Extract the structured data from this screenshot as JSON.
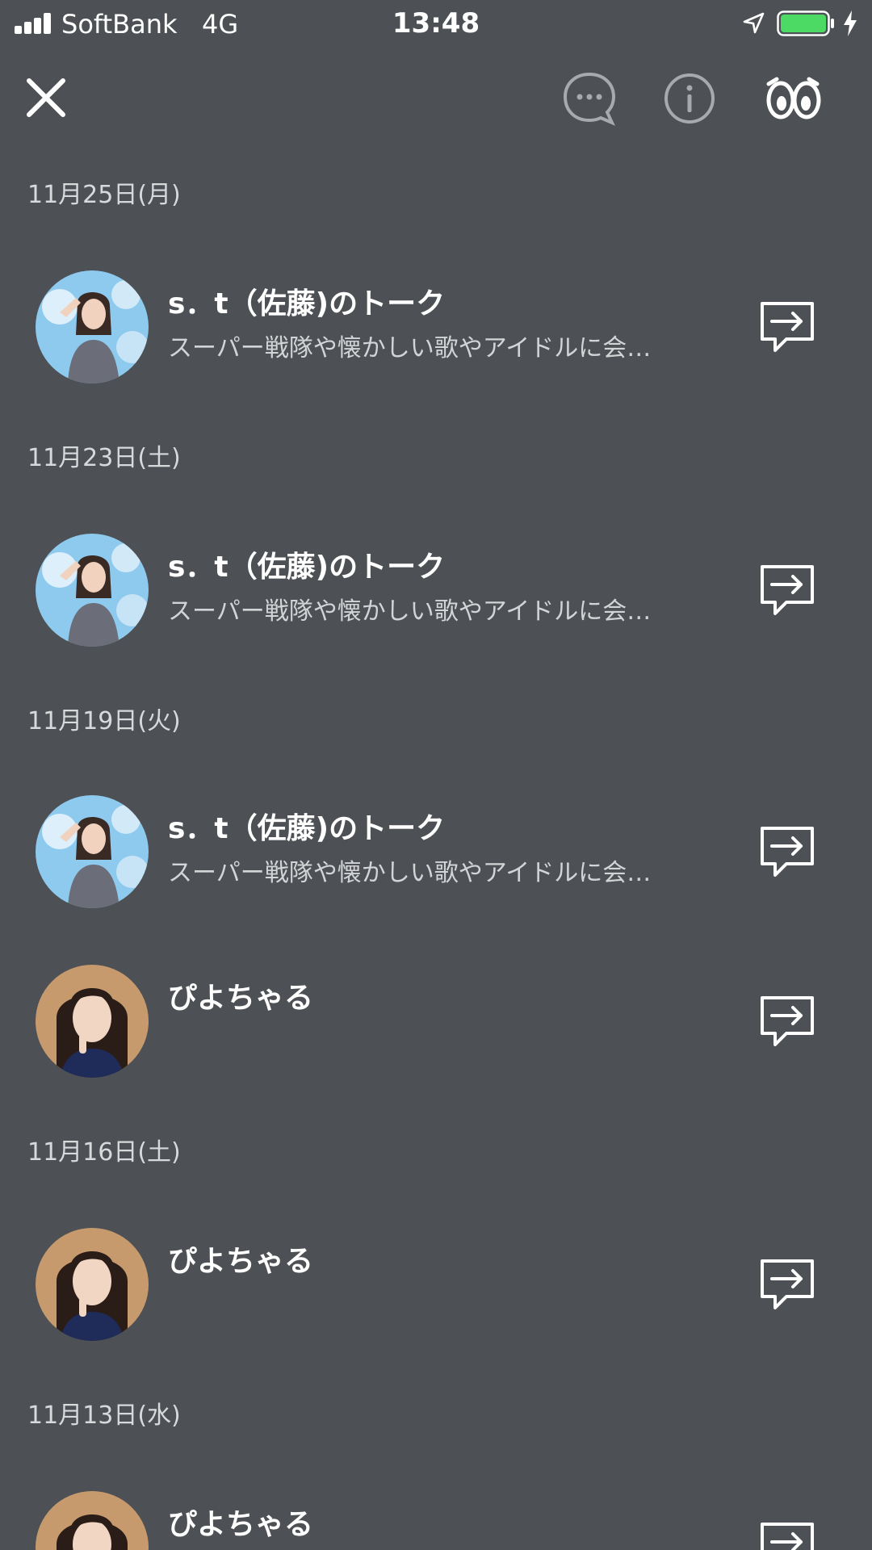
{
  "status_bar": {
    "carrier": "SoftBank",
    "network": "4G",
    "time": "13:48",
    "signal_bars": 4,
    "battery_level": 1.0,
    "battery_color": "#4cd964"
  },
  "toolbar": {
    "close_icon": "close-icon",
    "chat_icon": "speech-bubble-ellipsis-icon",
    "info_icon": "info-icon",
    "eyes_icon": "eyes-icon"
  },
  "groups": [
    {
      "date": "11月25日(月)",
      "items": [
        {
          "title": "s．t（佐藤)のトーク",
          "subtitle": "スーパー戦隊や懐かしい歌やアイドルに会…",
          "avatar": "girl-blue-avatar"
        }
      ]
    },
    {
      "date": "11月23日(土)",
      "items": [
        {
          "title": "s．t（佐藤)のトーク",
          "subtitle": "スーパー戦隊や懐かしい歌やアイドルに会…",
          "avatar": "girl-blue-avatar"
        }
      ]
    },
    {
      "date": "11月19日(火)",
      "items": [
        {
          "title": "s．t（佐藤)のトーク",
          "subtitle": "スーパー戦隊や懐かしい歌やアイドルに会…",
          "avatar": "girl-blue-avatar"
        },
        {
          "title": "ぴよちゃる",
          "subtitle": "",
          "avatar": "woman-portrait-avatar"
        }
      ]
    },
    {
      "date": "11月16日(土)",
      "items": [
        {
          "title": "ぴよちゃる",
          "subtitle": "",
          "avatar": "woman-portrait-avatar"
        }
      ]
    },
    {
      "date": "11月13日(水)",
      "items": [
        {
          "title": "ぴよちゃる",
          "subtitle": "",
          "avatar": "woman-portrait-avatar"
        }
      ]
    }
  ],
  "colors": {
    "background": "#4d5054",
    "date_text": "#d8d9db",
    "title_text": "#ffffff",
    "subtitle_text": "#d3d4d6"
  }
}
